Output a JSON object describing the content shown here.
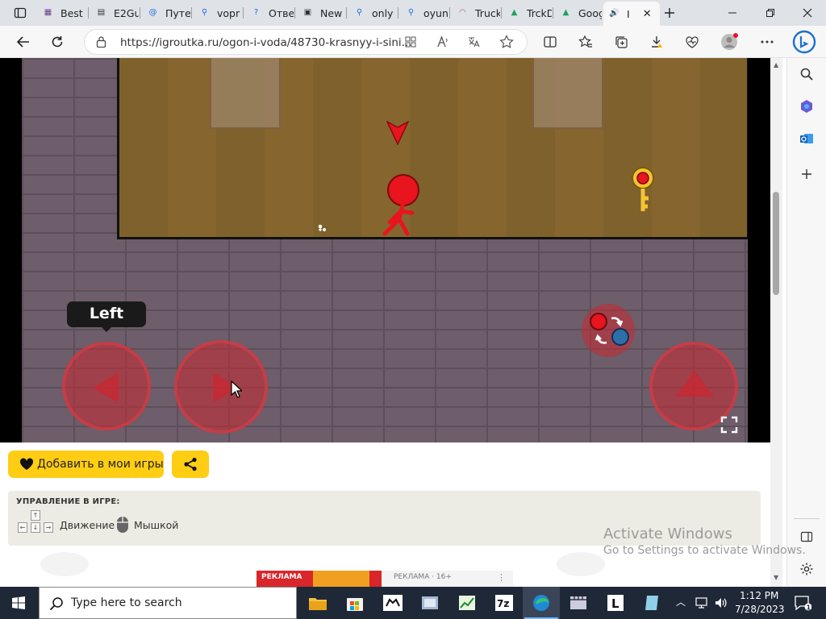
{
  "tabs": [
    {
      "label": "Best",
      "icon": "film-icon"
    },
    {
      "label": "E2Gu",
      "icon": "document-icon"
    },
    {
      "label": "Путе",
      "icon": "at-sign-icon"
    },
    {
      "label": "vopr",
      "icon": "search-icon"
    },
    {
      "label": "Отве",
      "icon": "question-icon"
    },
    {
      "label": "New",
      "icon": "newspaper-icon"
    },
    {
      "label": "only",
      "icon": "search-icon"
    },
    {
      "label": "oyun",
      "icon": "search-icon"
    },
    {
      "label": "Truck",
      "icon": "truck-icon"
    },
    {
      "label": "TrckD",
      "icon": "drive-icon"
    },
    {
      "label": "Goog",
      "icon": "drive-icon"
    },
    {
      "label": "I",
      "icon": "speaker-icon"
    }
  ],
  "address": {
    "url": "https://igroutka.ru/ogon-i-voda/48730-krasnyy-i-sini..."
  },
  "game": {
    "left_tooltip": "Left"
  },
  "page": {
    "add_button_label": "Добавить в мои игры",
    "controls_title": "УПРАВЛЕНИЕ В ИГРЕ:",
    "move_label": "Движение",
    "mouse_label": "Мышкой",
    "ad1": "РЕКЛАМА",
    "ad2": "РЕКЛАМА · 16+"
  },
  "watermark": {
    "title": "Activate Windows",
    "subtitle": "Go to Settings to activate Windows."
  },
  "taskbar": {
    "search_placeholder": "Type here to search",
    "time": "1:12 PM",
    "date": "7/28/2023"
  },
  "colors": {
    "accent": "#fecd14",
    "fire": "#e8141e",
    "water": "#2e6fa8",
    "taskbar": "#1f2836"
  }
}
